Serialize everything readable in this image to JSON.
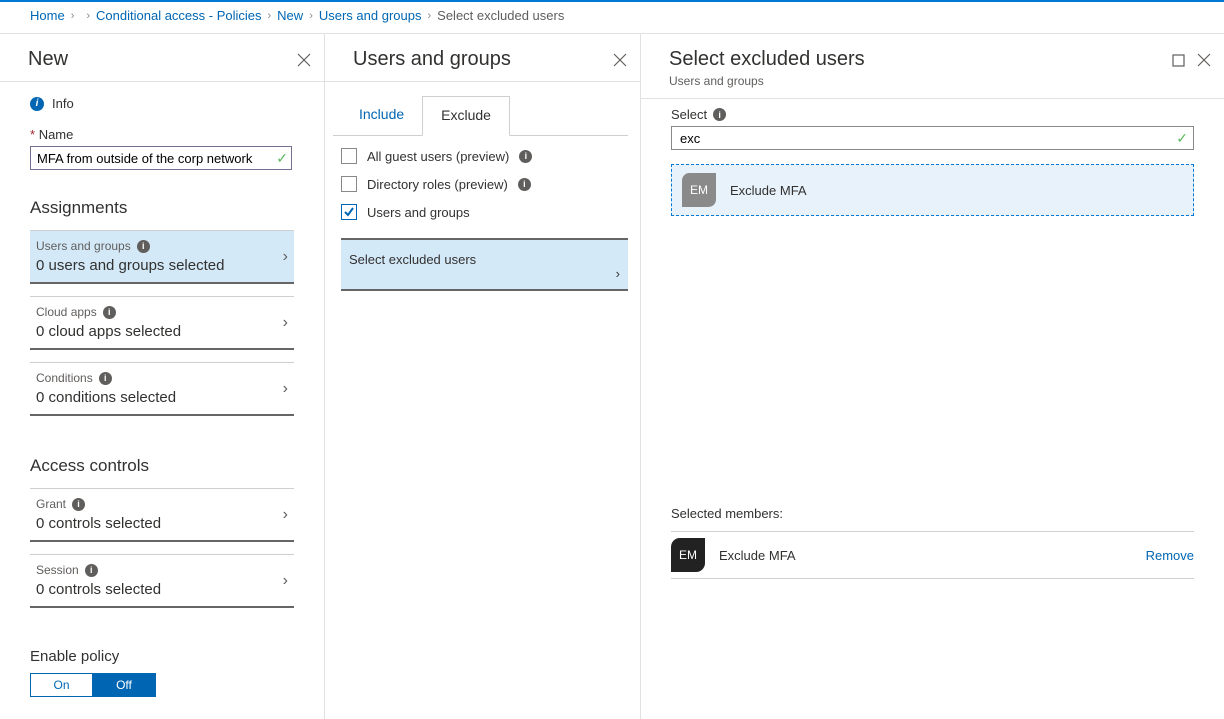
{
  "breadcrumb": {
    "home": "Home",
    "org": "",
    "policies": "Conditional access - Policies",
    "new": "New",
    "users_groups": "Users and groups",
    "current": "Select excluded users"
  },
  "blade1": {
    "title": "New",
    "info_label": "Info",
    "name_label": "Name",
    "name_value": "MFA from outside of the corp network",
    "sections": {
      "assignments": "Assignments",
      "access_controls": "Access controls"
    },
    "items": {
      "users_groups": {
        "label": "Users and groups",
        "value": "0 users and groups selected"
      },
      "cloud_apps": {
        "label": "Cloud apps",
        "value": "0 cloud apps selected"
      },
      "conditions": {
        "label": "Conditions",
        "value": "0 conditions selected"
      },
      "grant": {
        "label": "Grant",
        "value": "0 controls selected"
      },
      "session": {
        "label": "Session",
        "value": "0 controls selected"
      }
    },
    "enable_policy": {
      "label": "Enable policy",
      "on": "On",
      "off": "Off"
    }
  },
  "blade2": {
    "title": "Users and groups",
    "tabs": {
      "include": "Include",
      "exclude": "Exclude"
    },
    "opts": {
      "guests": "All guest users (preview)",
      "droles": "Directory roles (preview)",
      "ugroups": "Users and groups"
    },
    "select_excluded": "Select excluded users"
  },
  "blade3": {
    "title": "Select excluded users",
    "subtitle": "Users and groups",
    "select_label": "Select",
    "search_value": "exc",
    "result": {
      "initials": "EM",
      "name": "Exclude MFA"
    },
    "selected_members_label": "Selected members:",
    "selected_member": {
      "initials": "EM",
      "name": "Exclude MFA"
    },
    "remove_label": "Remove"
  }
}
